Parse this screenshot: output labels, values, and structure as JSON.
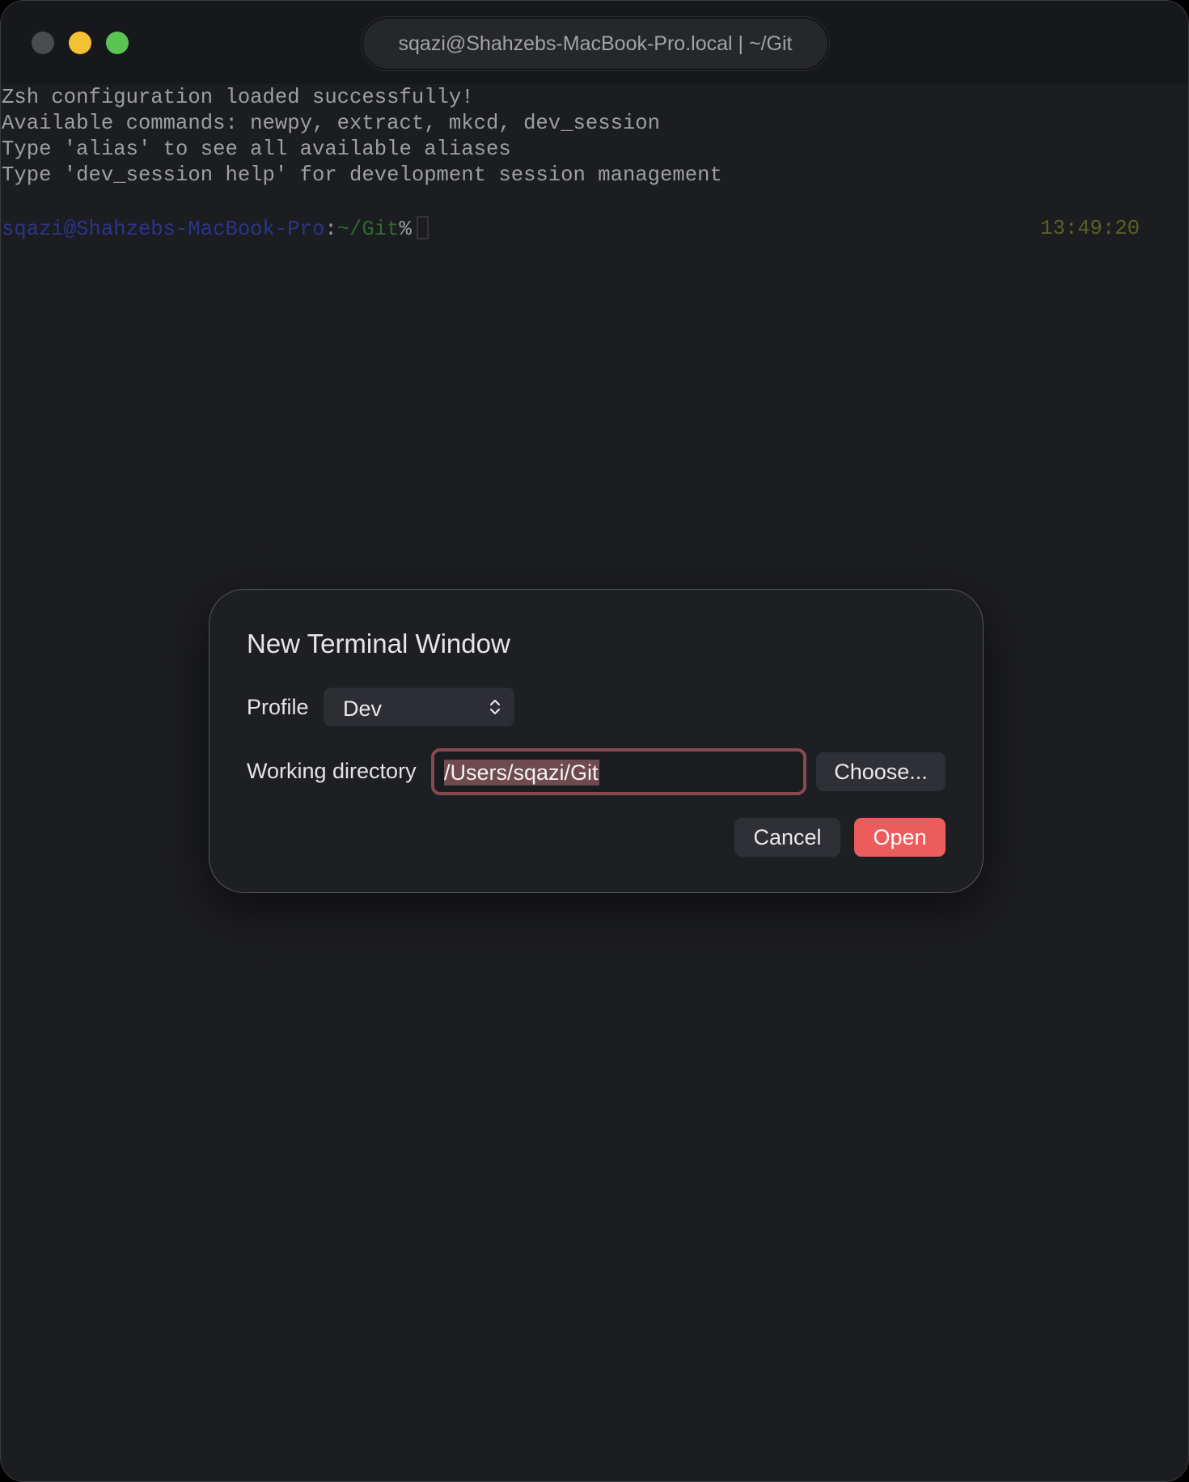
{
  "window": {
    "title": "sqazi@Shahzebs-MacBook-Pro.local | ~/Git",
    "traffic_lights": {
      "close_color": "#4a4b4f",
      "minimize_color": "#f5c134",
      "zoom_color": "#5ac351"
    }
  },
  "terminal": {
    "lines": [
      "Zsh configuration loaded successfully!",
      "Available commands: newpy, extract, mkcd, dev_session",
      "Type 'alias' to see all available aliases",
      "Type 'dev_session help' for development session management"
    ],
    "prompt": {
      "user_host": "sqazi@Shahzebs-MacBook-Pro",
      "colon": ":",
      "directory": "~/Git",
      "symbol": "%"
    },
    "right_prompt_time": "13:49:20"
  },
  "dialog": {
    "title": "New Terminal Window",
    "profile_label": "Profile",
    "profile_value": "Dev",
    "working_directory_label": "Working directory",
    "working_directory_value": "/Users/sqazi/Git",
    "choose_button": "Choose...",
    "cancel_button": "Cancel",
    "open_button": "Open",
    "accent_color": "#ec5c5c"
  }
}
